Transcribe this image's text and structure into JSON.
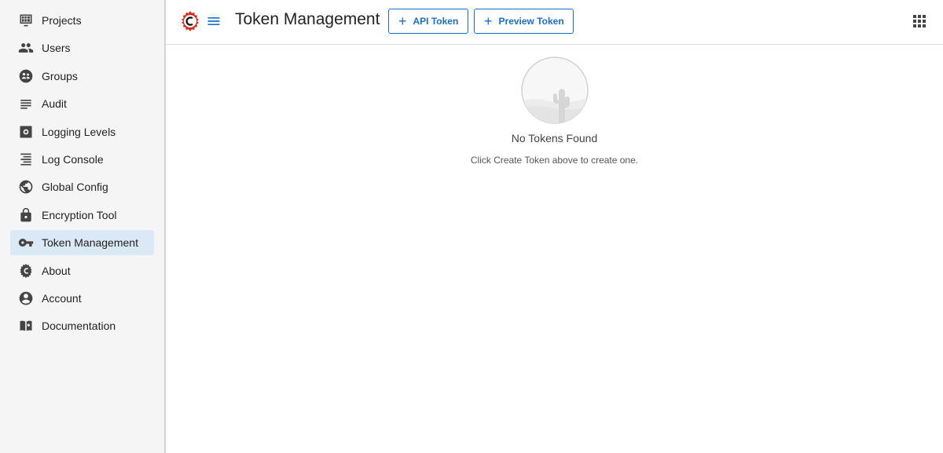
{
  "sidebar": {
    "items": [
      {
        "label": "Projects",
        "icon": "projects-icon"
      },
      {
        "label": "Users",
        "icon": "users-icon"
      },
      {
        "label": "Groups",
        "icon": "groups-icon"
      },
      {
        "label": "Audit",
        "icon": "audit-icon"
      },
      {
        "label": "Logging Levels",
        "icon": "logging-levels-icon"
      },
      {
        "label": "Log Console",
        "icon": "log-console-icon"
      },
      {
        "label": "Global Config",
        "icon": "globe-icon"
      },
      {
        "label": "Encryption Tool",
        "icon": "lock-icon"
      },
      {
        "label": "Token Management",
        "icon": "key-icon",
        "active": true
      },
      {
        "label": "About",
        "icon": "about-logo-icon"
      },
      {
        "label": "Account",
        "icon": "account-icon"
      },
      {
        "label": "Documentation",
        "icon": "book-icon"
      }
    ]
  },
  "header": {
    "title": "Token Management",
    "api_token_label": "API Token",
    "preview_token_label": "Preview Token"
  },
  "empty_state": {
    "title": "No Tokens Found",
    "subtitle": "Click Create Token above to create one."
  },
  "colors": {
    "accent": "#1a6fc9",
    "brand": "#e0281c",
    "active_bg": "#dbe8f6"
  }
}
